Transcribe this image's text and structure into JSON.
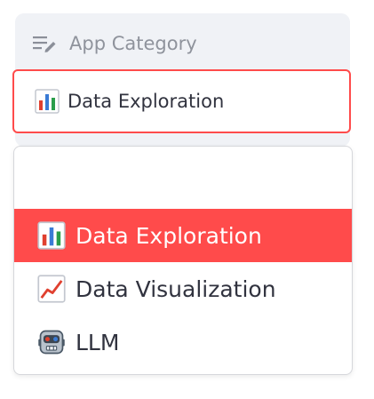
{
  "field": {
    "label": "App Category",
    "icon": "filter-list-icon"
  },
  "select": {
    "value_icon": "bar-chart-emoji-icon",
    "value": "Data Exploration",
    "accent_color": "#ff4b4b"
  },
  "dropdown": {
    "options": [
      {
        "icon": "bar-chart-emoji-icon",
        "label": "Data Exploration",
        "selected": true
      },
      {
        "icon": "chart-increasing-emoji-icon",
        "label": "Data Visualization",
        "selected": false
      },
      {
        "icon": "robot-emoji-icon",
        "label": "LLM",
        "selected": false
      }
    ]
  }
}
